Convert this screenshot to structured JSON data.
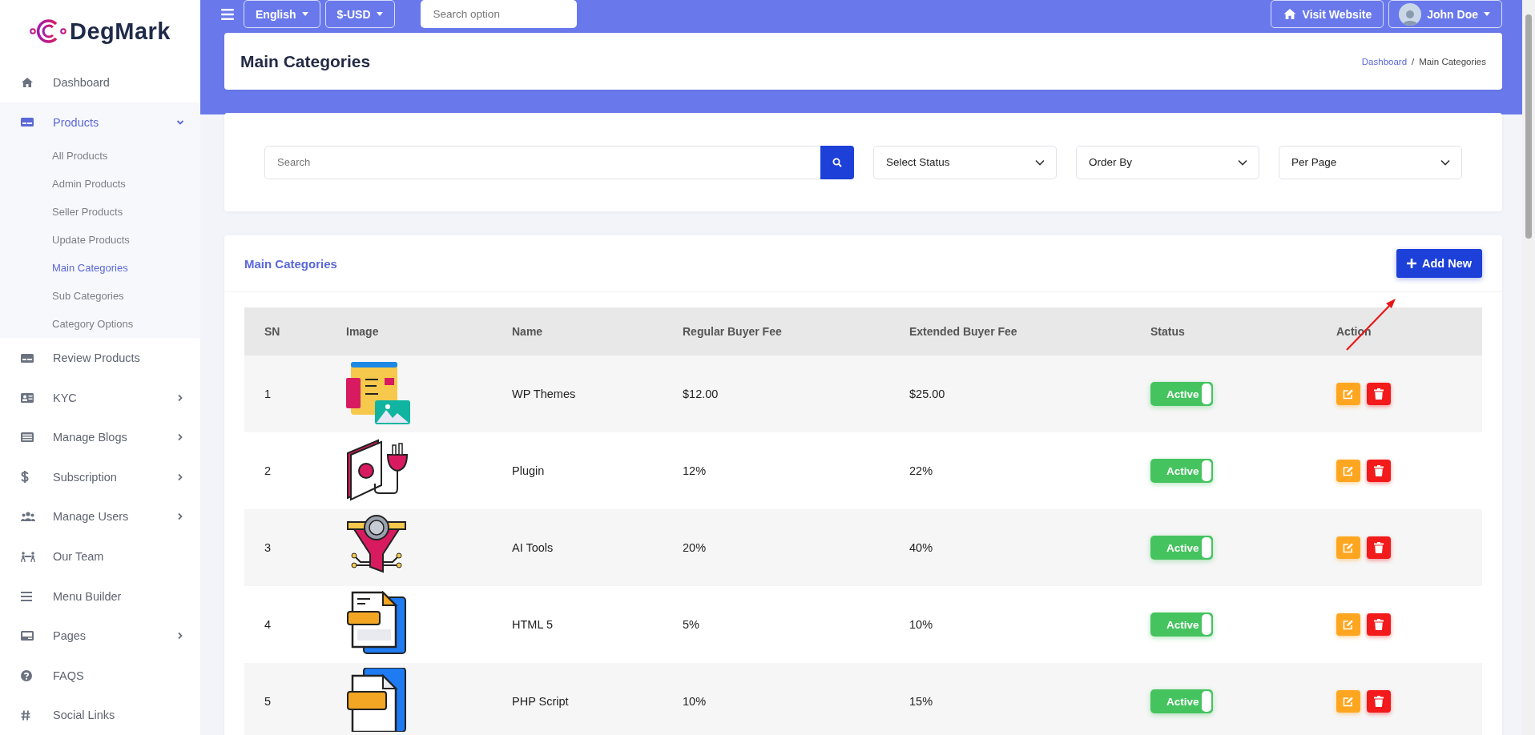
{
  "brand": {
    "name": "DegMark"
  },
  "sidebar": {
    "items": [
      {
        "label": "Dashboard",
        "selected": false
      },
      {
        "label": "Products",
        "selected": true,
        "expanded": true,
        "children": [
          {
            "label": "All Products",
            "selected": false
          },
          {
            "label": "Admin Products",
            "selected": false
          },
          {
            "label": "Seller Products",
            "selected": false
          },
          {
            "label": "Update Products",
            "selected": false
          },
          {
            "label": "Main Categories",
            "selected": true
          },
          {
            "label": "Sub Categories",
            "selected": false
          },
          {
            "label": "Category Options",
            "selected": false
          }
        ]
      },
      {
        "label": "Review Products",
        "selected": false
      },
      {
        "label": "KYC",
        "selected": false,
        "expanded": false
      },
      {
        "label": "Manage Blogs",
        "selected": false,
        "expanded": false
      },
      {
        "label": "Subscription",
        "selected": false,
        "expanded": false
      },
      {
        "label": "Manage Users",
        "selected": false,
        "expanded": false
      },
      {
        "label": "Our Team",
        "selected": false
      },
      {
        "label": "Menu Builder",
        "selected": false
      },
      {
        "label": "Pages",
        "selected": false,
        "expanded": false
      },
      {
        "label": "FAQS",
        "selected": false
      },
      {
        "label": "Social Links",
        "selected": false
      }
    ]
  },
  "topbar": {
    "language": "English",
    "currency": "$-USD",
    "search": {
      "placeholder": "Search option"
    },
    "visit_website": "Visit Website",
    "user": "John Doe"
  },
  "page_header": {
    "title": "Main Categories",
    "breadcrumb": {
      "link": "Dashboard",
      "separator": "/",
      "current": "Main Categories"
    }
  },
  "filters": {
    "search": {
      "placeholder": "Search"
    },
    "selects": [
      "Select Status",
      "Order By",
      "Per Page"
    ]
  },
  "table_card": {
    "title": "Main Categories",
    "add_button": "Add New",
    "columns": [
      "SN",
      "Image",
      "Name",
      "Regular Buyer Fee",
      "Extended Buyer Fee",
      "Status",
      "Action"
    ],
    "rows": [
      {
        "sn": "1",
        "name": "WP Themes",
        "regular_fee": "$12.00",
        "extended_fee": "$25.00",
        "status": {
          "label": "Active",
          "on": true
        }
      },
      {
        "sn": "2",
        "name": "Plugin",
        "regular_fee": "12%",
        "extended_fee": "22%",
        "status": {
          "label": "Active",
          "on": true
        }
      },
      {
        "sn": "3",
        "name": "AI Tools",
        "regular_fee": "20%",
        "extended_fee": "40%",
        "status": {
          "label": "Active",
          "on": true
        }
      },
      {
        "sn": "4",
        "name": "HTML 5",
        "regular_fee": "5%",
        "extended_fee": "10%",
        "status": {
          "label": "Active",
          "on": true
        }
      },
      {
        "sn": "5",
        "name": "PHP Script",
        "regular_fee": "10%",
        "extended_fee": "15%",
        "status": {
          "label": "Active",
          "on": true
        }
      }
    ]
  }
}
